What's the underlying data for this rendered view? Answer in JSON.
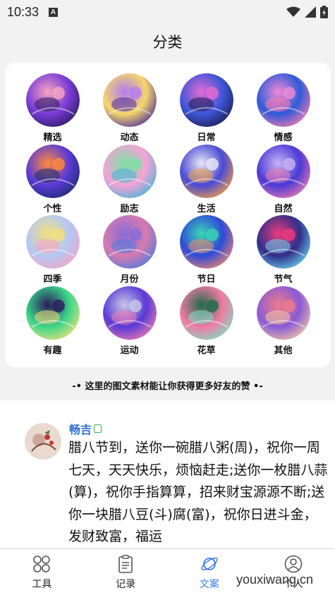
{
  "status_bar": {
    "time": "10:33",
    "notification_icon": "A"
  },
  "header": {
    "title": "分类"
  },
  "categories": [
    {
      "label": "精选",
      "icon": "rabbits-illustration",
      "colors": [
        "#f7a3c2",
        "#7a3bd6",
        "#2a1a5e"
      ]
    },
    {
      "label": "动态",
      "icon": "swirl-illustration",
      "colors": [
        "#b37bf0",
        "#f5d66b",
        "#4a2aa0"
      ]
    },
    {
      "label": "日常",
      "icon": "girl-night-illustration",
      "colors": [
        "#e56bd3",
        "#3d56d8",
        "#1b1b4f"
      ]
    },
    {
      "label": "情感",
      "icon": "fairy-illustration",
      "colors": [
        "#f08ad6",
        "#2f5bd8",
        "#ff7bb0"
      ]
    },
    {
      "label": "个性",
      "icon": "whale-illustration",
      "colors": [
        "#ff8a3d",
        "#5b3ad6",
        "#1a2b6e"
      ]
    },
    {
      "label": "励志",
      "icon": "garden-illustration",
      "colors": [
        "#7be0a3",
        "#f5a3d6",
        "#3fb6d8"
      ]
    },
    {
      "label": "生活",
      "icon": "cat-illustration",
      "colors": [
        "#e8e8f5",
        "#4a4ad6",
        "#f5a33d"
      ]
    },
    {
      "label": "自然",
      "icon": "dolphin-illustration",
      "colors": [
        "#c8b3f5",
        "#4a3ad6",
        "#f07bb0"
      ]
    },
    {
      "label": "四季",
      "icon": "moon-illustration",
      "colors": [
        "#f5e07b",
        "#b3c8f5",
        "#f5a3c2"
      ]
    },
    {
      "label": "月份",
      "icon": "mushroom-illustration",
      "colors": [
        "#8a6bd6",
        "#d67bb0",
        "#4a7be0"
      ]
    },
    {
      "label": "节日",
      "icon": "ocean-illustration",
      "colors": [
        "#3ad6b3",
        "#2f4ad8",
        "#f08a6b"
      ]
    },
    {
      "label": "节气",
      "icon": "coral-illustration",
      "colors": [
        "#f03a7b",
        "#2f2f8a",
        "#6bd6f0"
      ]
    },
    {
      "label": "有趣",
      "icon": "island-illustration",
      "colors": [
        "#2a1a5e",
        "#3ad68a",
        "#f5e07b"
      ]
    },
    {
      "label": "运动",
      "icon": "shark-illustration",
      "colors": [
        "#c8c8e8",
        "#5a3ad6",
        "#f07bb0"
      ]
    },
    {
      "label": "花草",
      "icon": "flamingo-illustration",
      "colors": [
        "#1f6b4a",
        "#f07ba3",
        "#7be0c8"
      ]
    },
    {
      "label": "其他",
      "icon": "jellyfish-illustration",
      "colors": [
        "#f07b8a",
        "#8a5ad6",
        "#f5c8a3"
      ]
    }
  ],
  "tagline": "-• 这里的图文素材能让你获得更多好友的赞 •-",
  "post": {
    "author": "畅吉",
    "text": "腊八节到，送你一碗腊八粥(周)，祝你一周七天，天天快乐，烦恼赶走;送你一枚腊八蒜(算)，祝你手指算算，招来财宝源源不断;送你一块腊八豆(斗)腐(富)，祝你日进斗金，发财致富，福运"
  },
  "bottom_nav": [
    {
      "label": "工具",
      "icon": "grid-circles-icon",
      "active": false
    },
    {
      "label": "记录",
      "icon": "clipboard-icon",
      "active": false
    },
    {
      "label": "文案",
      "icon": "planet-icon",
      "active": true
    },
    {
      "label": "个人",
      "icon": "user-icon",
      "active": false
    }
  ],
  "watermark": "youxiwang.cn",
  "colors": {
    "accent": "#3b7be8",
    "author": "#2b6fd6"
  }
}
